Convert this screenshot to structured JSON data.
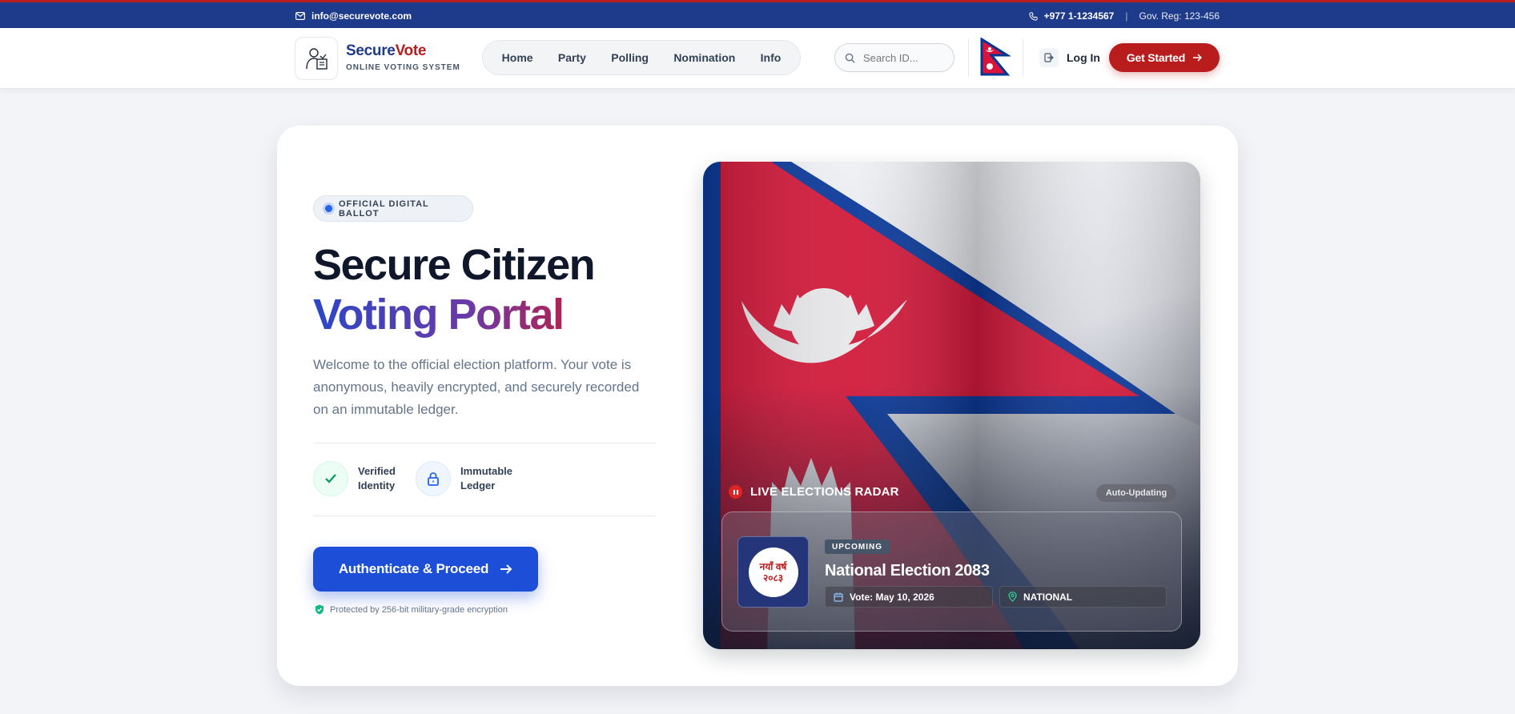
{
  "topbar": {
    "email": "info@securevote.com",
    "phone": "+977 1-1234567",
    "separator": "|",
    "reg": "Gov. Reg: 123-456"
  },
  "brand": {
    "name_part1": "Secure",
    "name_part2": "Vote",
    "subtitle": "ONLINE VOTING SYSTEM"
  },
  "nav": {
    "items": [
      {
        "label": "Home"
      },
      {
        "label": "Party"
      },
      {
        "label": "Polling"
      },
      {
        "label": "Nomination"
      },
      {
        "label": "Info"
      }
    ]
  },
  "search": {
    "placeholder": "Search ID..."
  },
  "auth": {
    "login_label": "Log In",
    "get_started_label": "Get Started"
  },
  "hero": {
    "badge": "OFFICIAL DIGITAL BALLOT",
    "title_line1": "Secure Citizen",
    "title_line2": "Voting Portal",
    "description": "Welcome to the official election platform. Your vote is anonymous, heavily encrypted, and securely recorded on an immutable ledger.",
    "features": [
      {
        "label": "Verified Identity",
        "icon": "check-icon"
      },
      {
        "label": "Immutable Ledger",
        "icon": "lock-icon"
      }
    ],
    "cta_label": "Authenticate & Proceed",
    "protection_note": "Protected by 256-bit military-grade encryption"
  },
  "radar": {
    "title": "LIVE ELECTIONS RADAR",
    "status": "Auto-Updating",
    "election": {
      "badge": "UPCOMING",
      "title": "National Election 2083",
      "vote_date": "Vote: May 10, 2026",
      "scope": "NATIONAL",
      "logo_text_line1": "नयाँ वर्ष",
      "logo_text_line2": "२०८३"
    }
  },
  "colors": {
    "brand_blue": "#1e3a8a",
    "brand_red": "#b91c1c",
    "cta_blue": "#1d4ed8",
    "flag_crimson": "#dc143c",
    "flag_blue": "#003893"
  }
}
